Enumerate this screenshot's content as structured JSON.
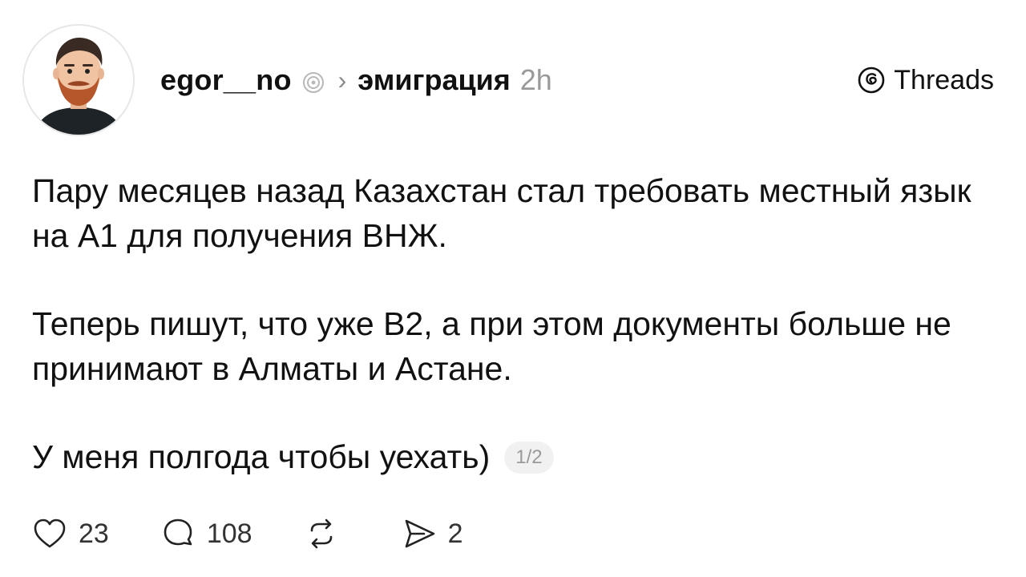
{
  "post": {
    "author": {
      "username": "egor__no",
      "avatar_alt": "avatar"
    },
    "topic": "эмиграция",
    "time": "2h",
    "brand": "Threads",
    "paragraphs": [
      "Пару месяцев назад Казахстан стал требовать местный язык на А1 для получения ВНЖ.",
      "Теперь пишут, что уже В2, а при этом документы больше не принимают в Алматы и Астане.",
      "У меня полгода чтобы уехать)"
    ],
    "pager": "1/2",
    "actions": {
      "likes": "23",
      "replies": "108",
      "reposts": "",
      "shares": "2"
    }
  },
  "colors": {
    "text": "#111111",
    "muted": "#9a9a9a",
    "beard": "#b5562b"
  },
  "icons": [
    "verified-icon",
    "chevron-right-icon",
    "threads-logo-icon",
    "heart-icon",
    "comment-icon",
    "repost-icon",
    "share-icon"
  ]
}
